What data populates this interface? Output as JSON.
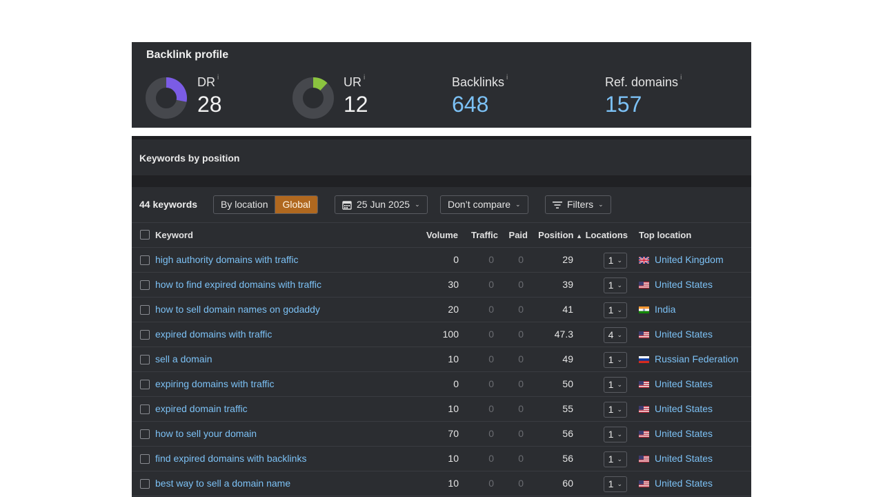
{
  "backlink_profile": {
    "title": "Backlink profile",
    "dr": {
      "label": "DR",
      "info": "i",
      "value": "28",
      "fraction": 0.28,
      "color": "#7b5ce6"
    },
    "ur": {
      "label": "UR",
      "info": "i",
      "value": "12",
      "fraction": 0.12,
      "color": "#8bc43f"
    },
    "backlinks": {
      "label": "Backlinks",
      "info": "i",
      "value": "648"
    },
    "ref_domains": {
      "label": "Ref. domains",
      "info": "i",
      "value": "157"
    }
  },
  "keywords": {
    "title": "Keywords by position",
    "count_label": "44 keywords",
    "segment": {
      "by_location": "By location",
      "global": "Global",
      "selected": "Global"
    },
    "date_label": "25 Jun 2025",
    "compare_label": "Don’t compare",
    "filters_label": "Filters",
    "columns": {
      "keyword": "Keyword",
      "volume": "Volume",
      "traffic": "Traffic",
      "paid": "Paid",
      "position": "Position",
      "locations": "Locations",
      "top_location": "Top location"
    },
    "rows": [
      {
        "keyword": "high authority domains with traffic",
        "volume": "0",
        "traffic": "0",
        "paid": "0",
        "position": "29",
        "locations": "1",
        "country": "United Kingdom",
        "flag": "uk"
      },
      {
        "keyword": "how to find expired domains with traffic",
        "volume": "30",
        "traffic": "0",
        "paid": "0",
        "position": "39",
        "locations": "1",
        "country": "United States",
        "flag": "us"
      },
      {
        "keyword": "how to sell domain names on godaddy",
        "volume": "20",
        "traffic": "0",
        "paid": "0",
        "position": "41",
        "locations": "1",
        "country": "India",
        "flag": "in"
      },
      {
        "keyword": "expired domains with traffic",
        "volume": "100",
        "traffic": "0",
        "paid": "0",
        "position": "47.3",
        "locations": "4",
        "country": "United States",
        "flag": "us"
      },
      {
        "keyword": "sell a domain",
        "volume": "10",
        "traffic": "0",
        "paid": "0",
        "position": "49",
        "locations": "1",
        "country": "Russian Federation",
        "flag": "ru"
      },
      {
        "keyword": "expiring domains with traffic",
        "volume": "0",
        "traffic": "0",
        "paid": "0",
        "position": "50",
        "locations": "1",
        "country": "United States",
        "flag": "us"
      },
      {
        "keyword": "expired domain traffic",
        "volume": "10",
        "traffic": "0",
        "paid": "0",
        "position": "55",
        "locations": "1",
        "country": "United States",
        "flag": "us"
      },
      {
        "keyword": "how to sell your domain",
        "volume": "70",
        "traffic": "0",
        "paid": "0",
        "position": "56",
        "locations": "1",
        "country": "United States",
        "flag": "us"
      },
      {
        "keyword": "find expired domains with backlinks",
        "volume": "10",
        "traffic": "0",
        "paid": "0",
        "position": "56",
        "locations": "1",
        "country": "United States",
        "flag": "us"
      },
      {
        "keyword": "best way to sell a domain name",
        "volume": "10",
        "traffic": "0",
        "paid": "0",
        "position": "60",
        "locations": "1",
        "country": "United States",
        "flag": "us"
      }
    ]
  }
}
